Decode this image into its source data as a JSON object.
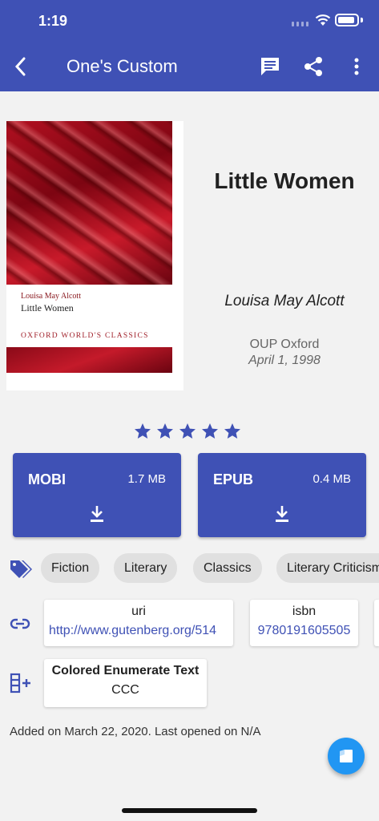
{
  "status": {
    "time": "1:19"
  },
  "appbar": {
    "title": "One's Custom"
  },
  "cover": {
    "author": "Louisa May Alcott",
    "title": "Little Women",
    "publisher": "OXFORD WORLD'S CLASSICS"
  },
  "book": {
    "title": "Little Women",
    "author": "Louisa May Alcott",
    "publisher": "OUP Oxford",
    "date": "April 1, 1998",
    "rating": 5,
    "rating_max": 5
  },
  "downloads": [
    {
      "format": "MOBI",
      "size": "1.7 MB"
    },
    {
      "format": "EPUB",
      "size": "0.4 MB"
    }
  ],
  "tags": [
    "Fiction",
    "Literary",
    "Classics",
    "Literary Criticism"
  ],
  "identifiers": [
    {
      "key": "uri",
      "value": "http://www.gutenberg.org/514"
    },
    {
      "key": "isbn",
      "value": "9780191605505"
    }
  ],
  "custom_column": {
    "name": "Colored Enumerate Text",
    "value": "CCC"
  },
  "footer": {
    "added": "Added on March 22, 2020. Last opened on N/A"
  },
  "colors": {
    "primary": "#3f51b5",
    "fab": "#2196f3"
  }
}
